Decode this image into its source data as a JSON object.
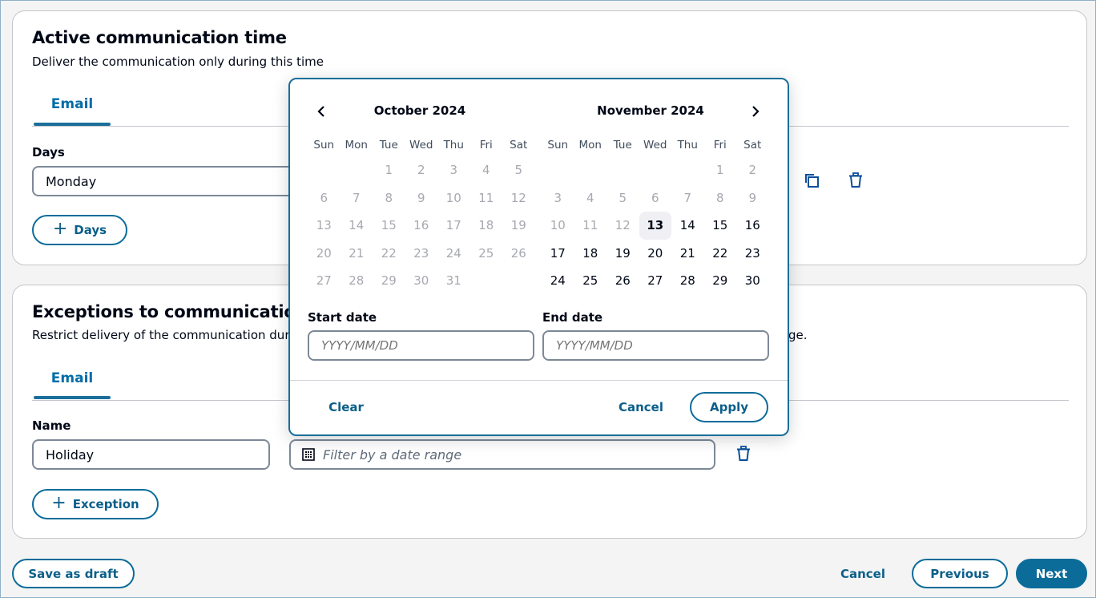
{
  "active_time": {
    "title": "Active communication time",
    "description": "Deliver the communication only during this time",
    "tab_label": "Email",
    "days_label": "Days",
    "days_value": "Monday",
    "add_days_label": "Days",
    "icons": [
      "copy-icon",
      "trash-icon"
    ]
  },
  "exceptions": {
    "title": "Exceptions to communication",
    "description_visible_start": "Restrict delivery of the communication dur",
    "description_visible_end": "ge.",
    "tab_label": "Email",
    "name_label": "Name",
    "name_value": "Holiday",
    "date_range_placeholder": "Filter by a date range",
    "add_exception_label": "Exception"
  },
  "calendar": {
    "weekdays": [
      "Sun",
      "Mon",
      "Tue",
      "Wed",
      "Thu",
      "Fri",
      "Sat"
    ],
    "months": [
      {
        "title": "October 2024",
        "first_weekday": 2,
        "days_in_month": 31,
        "enabled_from": 32
      },
      {
        "title": "November 2024",
        "first_weekday": 5,
        "days_in_month": 30,
        "enabled_from": 13
      }
    ],
    "today": "November 13, 2024",
    "today_month_index": 1,
    "today_day": 13,
    "start_date_label": "Start date",
    "start_date_placeholder": "YYYY/MM/DD",
    "end_date_label": "End date",
    "end_date_placeholder": "YYYY/MM/DD",
    "clear_label": "Clear",
    "cancel_label": "Cancel",
    "apply_label": "Apply"
  },
  "footer": {
    "save_draft_label": "Save as draft",
    "cancel_label": "Cancel",
    "previous_label": "Previous",
    "next_label": "Next"
  },
  "colors": {
    "accent": "#0b6c9a",
    "text": "#000716",
    "disabled": "#a7a9b0",
    "today_bg": "#f0f0f4"
  }
}
